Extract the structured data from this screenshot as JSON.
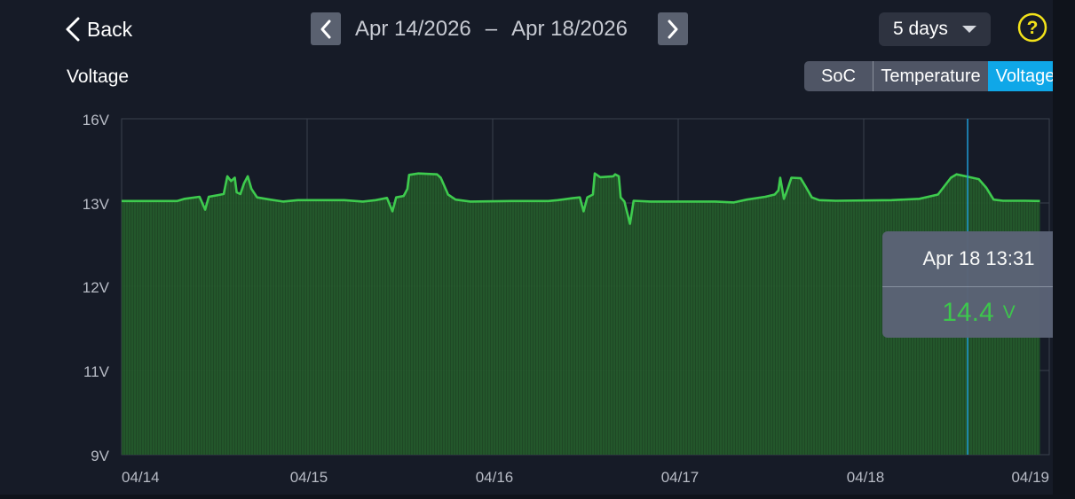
{
  "header": {
    "back_label": "Back",
    "date_start": "Apr 14/2026",
    "date_dash": "–",
    "date_end": "Apr 18/2026",
    "range_selected": "5 days",
    "help_symbol": "?"
  },
  "chart_title": "Voltage",
  "tabs": [
    {
      "label": "SoC",
      "active": false
    },
    {
      "label": "Temperature",
      "active": false
    },
    {
      "label": "Voltage",
      "active": true
    }
  ],
  "tooltip": {
    "time": "Apr 18 13:31",
    "value": "14.4",
    "unit": "V"
  },
  "colors": {
    "background": "#161b27",
    "line": "#3ecb4e",
    "fill": "#2c6e33",
    "active_tab": "#0fa7e8",
    "help_icon": "#f2e21a",
    "cursor": "#1f9bd6"
  },
  "chart_data": {
    "type": "area",
    "title": "Voltage",
    "y_tick_labels": [
      "16V",
      "13V",
      "12V",
      "11V",
      "9V"
    ],
    "x_tick_labels": [
      "04/14",
      "04/15",
      "04/16",
      "04/17",
      "04/18",
      "04/19"
    ],
    "x_domain_days": [
      0,
      5
    ],
    "y_axis_note": "non-linear tick spacing: 9V, 11V, 12V, 13V, 16V evenly spaced",
    "series": [
      {
        "values": [
          [
            0.0,
            13.07
          ],
          [
            0.3,
            13.07
          ],
          [
            0.34,
            13.15
          ],
          [
            0.42,
            13.22
          ],
          [
            0.45,
            12.92
          ],
          [
            0.47,
            13.22
          ],
          [
            0.52,
            13.28
          ],
          [
            0.55,
            13.32
          ],
          [
            0.57,
            13.95
          ],
          [
            0.59,
            13.78
          ],
          [
            0.61,
            13.9
          ],
          [
            0.62,
            13.38
          ],
          [
            0.64,
            13.32
          ],
          [
            0.66,
            13.7
          ],
          [
            0.68,
            13.95
          ],
          [
            0.7,
            13.5
          ],
          [
            0.73,
            13.2
          ],
          [
            0.8,
            13.12
          ],
          [
            0.87,
            13.05
          ],
          [
            0.95,
            13.1
          ],
          [
            1.2,
            13.1
          ],
          [
            1.3,
            13.05
          ],
          [
            1.37,
            13.1
          ],
          [
            1.43,
            13.18
          ],
          [
            1.46,
            12.9
          ],
          [
            1.48,
            13.2
          ],
          [
            1.52,
            13.25
          ],
          [
            1.54,
            13.5
          ],
          [
            1.55,
            14.0
          ],
          [
            1.6,
            14.05
          ],
          [
            1.7,
            14.02
          ],
          [
            1.72,
            13.9
          ],
          [
            1.76,
            13.3
          ],
          [
            1.8,
            13.12
          ],
          [
            1.88,
            13.05
          ],
          [
            2.1,
            13.07
          ],
          [
            2.3,
            13.07
          ],
          [
            2.35,
            13.1
          ],
          [
            2.43,
            13.17
          ],
          [
            2.47,
            13.2
          ],
          [
            2.49,
            12.9
          ],
          [
            2.51,
            13.2
          ],
          [
            2.54,
            13.3
          ],
          [
            2.55,
            14.05
          ],
          [
            2.58,
            13.92
          ],
          [
            2.65,
            13.95
          ],
          [
            2.66,
            14.02
          ],
          [
            2.68,
            13.95
          ],
          [
            2.69,
            13.2
          ],
          [
            2.71,
            13.05
          ],
          [
            2.74,
            12.75
          ],
          [
            2.76,
            13.08
          ],
          [
            2.85,
            13.05
          ],
          [
            3.2,
            13.05
          ],
          [
            3.3,
            13.02
          ],
          [
            3.37,
            13.12
          ],
          [
            3.47,
            13.22
          ],
          [
            3.52,
            13.3
          ],
          [
            3.54,
            13.45
          ],
          [
            3.55,
            13.9
          ],
          [
            3.57,
            13.15
          ],
          [
            3.59,
            13.5
          ],
          [
            3.61,
            13.9
          ],
          [
            3.66,
            13.88
          ],
          [
            3.69,
            13.55
          ],
          [
            3.72,
            13.2
          ],
          [
            3.76,
            13.1
          ],
          [
            3.85,
            13.08
          ],
          [
            4.15,
            13.1
          ],
          [
            4.3,
            13.15
          ],
          [
            4.4,
            13.3
          ],
          [
            4.47,
            13.9
          ],
          [
            4.5,
            14.02
          ],
          [
            4.55,
            13.95
          ],
          [
            4.62,
            13.85
          ],
          [
            4.66,
            13.55
          ],
          [
            4.7,
            13.12
          ],
          [
            4.75,
            13.08
          ],
          [
            4.87,
            13.08
          ],
          [
            4.95,
            13.07
          ]
        ]
      }
    ],
    "cursor_x_day": 4.56
  }
}
